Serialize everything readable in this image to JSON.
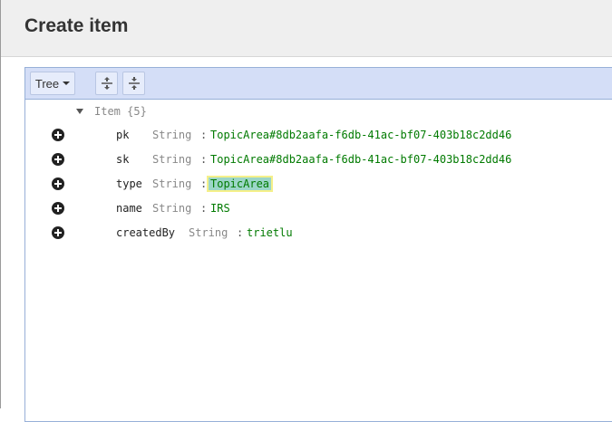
{
  "header": {
    "title": "Create item"
  },
  "toolbar": {
    "mode_label": "Tree",
    "expand_all_icon": "expand-all-icon",
    "collapse_all_icon": "collapse-all-icon"
  },
  "tree": {
    "root_label": "Item {5}",
    "fields": [
      {
        "name": "pk",
        "type": "String",
        "value": "TopicArea#8db2aafa-f6db-41ac-bf07-403b18c2dd46"
      },
      {
        "name": "sk",
        "type": "String",
        "value": "TopicArea#8db2aafa-f6db-41ac-bf07-403b18c2dd46"
      },
      {
        "name": "type",
        "type": "String",
        "value": "TopicArea",
        "selected": true
      },
      {
        "name": "name",
        "type": "String",
        "value": "IRS"
      },
      {
        "name": "createdBy",
        "type": "String",
        "value": "trietlu"
      }
    ]
  },
  "colors": {
    "value_text": "#007a00",
    "toolbar_bg": "#d4def7",
    "header_bg": "#efefef"
  }
}
